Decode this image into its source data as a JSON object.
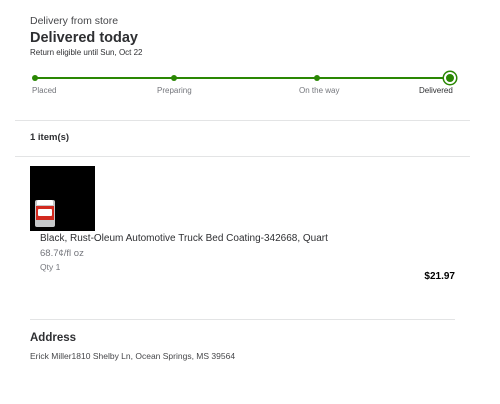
{
  "order": {
    "delivery_type": "Delivery from store",
    "status_title": "Delivered today",
    "return_note": "Return eligible until Sun, Oct 22"
  },
  "tracker": {
    "steps": [
      {
        "label": "Placed"
      },
      {
        "label": "Preparing"
      },
      {
        "label": "On the way"
      },
      {
        "label": "Delivered"
      }
    ],
    "current_step": "Delivered",
    "accent_color": "#2a8703"
  },
  "items": {
    "count_label": "1 item(s)",
    "list": [
      {
        "name": "Black, Rust-Oleum Automotive Truck Bed Coating-342668, Quart",
        "unit_price": "68.7¢/fl oz",
        "quantity": "Qty 1",
        "total": "$21.97",
        "thumbnail_icon": "paint-can-icon"
      }
    ]
  },
  "address": {
    "heading": "Address",
    "text": "Erick Miller1810 Shelby Ln, Ocean Springs, MS 39564"
  }
}
